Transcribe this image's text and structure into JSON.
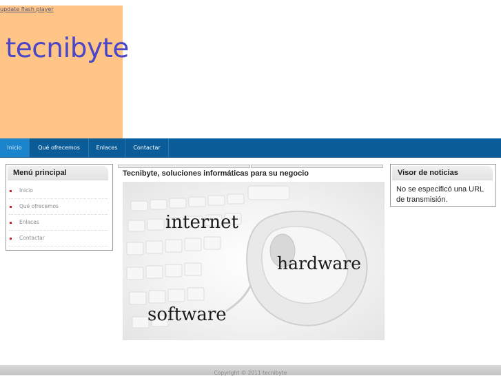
{
  "header": {
    "flash_link": "update flash player",
    "logo_text": "tecnibyte"
  },
  "nav": {
    "items": [
      "Inicio",
      "Qué ofrecemos",
      "Enlaces",
      "Contactar"
    ],
    "active_index": 0
  },
  "left_menu": {
    "title": "Menú principal",
    "items": [
      "Inicio",
      "Qué ofrecemos",
      "Enlaces",
      "Contactar"
    ]
  },
  "main": {
    "title": "Tecnibyte, soluciones informáticas para su negocio",
    "image_words": [
      "internet",
      "hardware",
      "software"
    ]
  },
  "news": {
    "title": "Visor de noticias",
    "text": "No se especificó una URL de transmisión."
  },
  "footer": {
    "copyright": "Copyright © 2011 tecnibyte"
  },
  "colors": {
    "banner": "#ffc586",
    "logo": "#4b45c8",
    "nav_bar": "#0b5d99",
    "nav_active": "#1a85cc",
    "bullet": "#cc2222"
  }
}
